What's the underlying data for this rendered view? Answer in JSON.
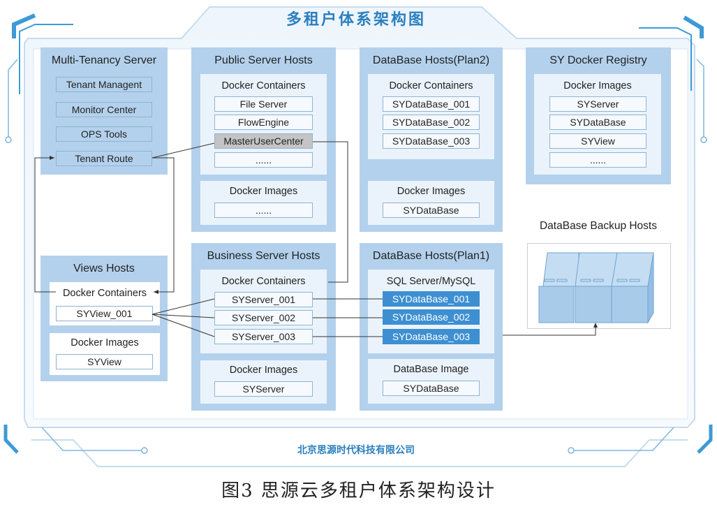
{
  "header": {
    "title": "多租户体系架构图"
  },
  "footer": {
    "company": "北京思源时代科技有限公司"
  },
  "caption": "图3 思源云多租户体系架构设计",
  "colors": {
    "accent": "#2a7fbf",
    "host_bg": "#b3d1ec",
    "panel_bg": "#eaf3fb",
    "db_highlight": "#3d8fd1",
    "selected_gray": "#c4c4c4"
  },
  "hosts": {
    "multi_tenancy": {
      "title": "Multi-Tenancy Server",
      "items": [
        "Tenant Managent",
        "Monitor Center",
        "OPS  Tools",
        "Tenant Route"
      ]
    },
    "public_server": {
      "title": "Public Server Hosts",
      "containers_title": "Docker Containers",
      "containers": [
        "File Server",
        "FlowEngine",
        "MasterUserCenter",
        "......"
      ],
      "images_title": "Docker Images",
      "images": [
        "......"
      ]
    },
    "db_plan2": {
      "title": "DataBase Hosts(Plan2)",
      "containers_title": "Docker Containers",
      "containers": [
        "SYDataBase_001",
        "SYDataBase_002",
        "SYDataBase_003"
      ],
      "images_title": "Docker Images",
      "images": [
        "SYDataBase"
      ]
    },
    "registry": {
      "title": "SY Docker Registry",
      "images_title": "Docker Images",
      "images": [
        "SYServer",
        "SYDataBase",
        "SYView",
        "......"
      ]
    },
    "views": {
      "title": "Views Hosts",
      "containers_title": "Docker Containers",
      "containers": [
        "SYView_001"
      ],
      "images_title": "Docker Images",
      "images": [
        "SYView"
      ]
    },
    "business": {
      "title": "Business Server Hosts",
      "containers_title": "Docker Containers",
      "containers": [
        "SYServer_001",
        "SYServer_002",
        "SYServer_003"
      ],
      "images_title": "Docker Images",
      "images": [
        "SYServer"
      ]
    },
    "db_plan1": {
      "title": "DataBase Hosts(Plan1)",
      "sql_title": "SQL Server/MySQL",
      "databases": [
        "SYDataBase_001",
        "SYDataBase_002",
        "SYDataBase_003"
      ],
      "image_title": "DataBase Image",
      "images": [
        "SYDataBase"
      ]
    },
    "backup": {
      "title": "DataBase Backup Hosts"
    }
  }
}
